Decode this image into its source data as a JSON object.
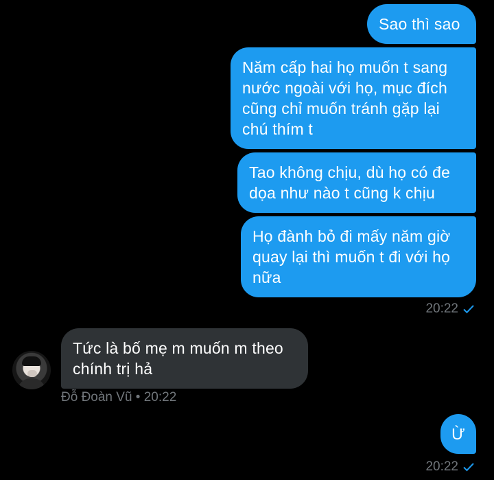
{
  "messages": [
    {
      "text": "Sao thì sao",
      "direction": "outgoing"
    },
    {
      "text": "Năm cấp hai họ muốn t sang nước ngoài với họ, mục đích cũng chỉ muốn tránh gặp lại chú thím t",
      "direction": "outgoing"
    },
    {
      "text": "Tao không chịu, dù họ có đe dọa như nào t cũng k chịu",
      "direction": "outgoing"
    },
    {
      "text": "Họ đành bỏ đi mấy năm giờ quay lại thì muốn t đi với họ nữa",
      "direction": "outgoing"
    },
    {
      "text": "Tức là bố mẹ m muốn m theo chính trị hả",
      "direction": "incoming"
    },
    {
      "text": "Ừ",
      "direction": "outgoing"
    }
  ],
  "timestamps": [
    "20:22",
    "20:22"
  ],
  "sender_label": "Đỗ Đoàn Vũ • 20:22",
  "colors": {
    "outgoing": "#1d9bf0",
    "incoming": "#2f3336",
    "meta": "#71767b",
    "background": "#000000"
  },
  "icons": {
    "read_receipt": "check-icon",
    "avatar": "user-avatar"
  }
}
